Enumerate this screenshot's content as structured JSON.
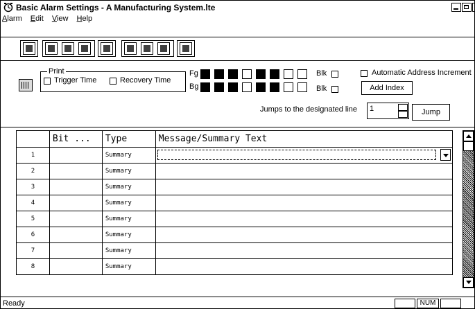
{
  "window": {
    "title": "Basic Alarm Settings - A Manufacturing System.lte"
  },
  "menu": [
    {
      "key": "A",
      "rest": "larm"
    },
    {
      "key": "E",
      "rest": "dit"
    },
    {
      "key": "V",
      "rest": "iew"
    },
    {
      "key": "H",
      "rest": "elp"
    }
  ],
  "toolbar": {
    "icons": [
      "save-icon",
      "cut-icon",
      "copy-icon",
      "paste-icon",
      "undo-icon",
      "insert-row-icon",
      "grid-icon",
      "settings-icon",
      "exit-icon"
    ]
  },
  "settings": {
    "print_group_label": "Print",
    "trigger_time_label": "Trigger Time",
    "recovery_time_label": "Recovery Time",
    "fg_label": "Fg",
    "bg_label": "Bg",
    "blk_label_fg": "Blk",
    "blk_label_bg": "Blk",
    "auto_address_label": "Automatic Address Increment",
    "add_index_label": "Add Index",
    "jumps_label": "Jumps to the designated line",
    "jump_line_value": "1",
    "jump_button_label": "Jump",
    "fg_colors": [
      "#000000",
      "#000000",
      "#000000",
      "#ffffff",
      "#000000",
      "#000000",
      "#ffffff",
      "#ffffff"
    ],
    "bg_colors": [
      "#000000",
      "#000000",
      "#000000",
      "#ffffff",
      "#000000",
      "#000000",
      "#ffffff",
      "#ffffff"
    ]
  },
  "grid": {
    "columns": [
      "",
      "Bit ...",
      "Type",
      "Message/Summary Text"
    ],
    "rows": [
      {
        "num": "1",
        "bit": "",
        "type": "Summary",
        "text": ""
      },
      {
        "num": "2",
        "bit": "",
        "type": "Summary",
        "text": ""
      },
      {
        "num": "3",
        "bit": "",
        "type": "Summary",
        "text": ""
      },
      {
        "num": "4",
        "bit": "",
        "type": "Summary",
        "text": ""
      },
      {
        "num": "5",
        "bit": "",
        "type": "Summary",
        "text": ""
      },
      {
        "num": "6",
        "bit": "",
        "type": "Summary",
        "text": ""
      },
      {
        "num": "7",
        "bit": "",
        "type": "Summary",
        "text": ""
      },
      {
        "num": "8",
        "bit": "",
        "type": "Summary",
        "text": ""
      }
    ]
  },
  "status": {
    "text": "Ready",
    "num_indicator": "NUM"
  }
}
